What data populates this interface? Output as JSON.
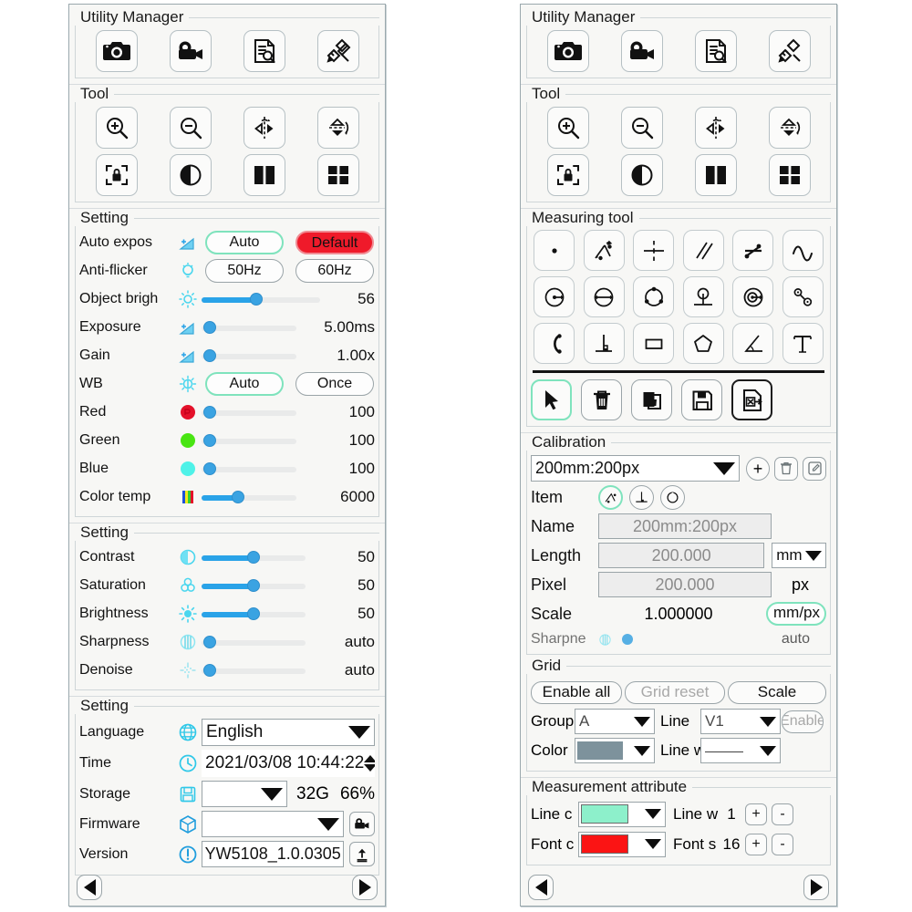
{
  "left_panel": {
    "utility": {
      "title": "Utility Manager",
      "buttons": [
        {
          "name": "snapshot-camera-icon",
          "label": "Snapshot"
        },
        {
          "name": "video-record-icon",
          "label": "Record"
        },
        {
          "name": "document-search-icon",
          "label": "Browse"
        },
        {
          "name": "ruler-pencil-icon",
          "label": "Measure"
        }
      ]
    },
    "tool": {
      "title": "Tool",
      "buttons": [
        {
          "name": "zoom-in-icon",
          "label": "Zoom in"
        },
        {
          "name": "zoom-out-icon",
          "label": "Zoom out"
        },
        {
          "name": "flip-horizontal-icon",
          "label": "Mirror"
        },
        {
          "name": "flip-vertical-icon",
          "label": "Flip"
        },
        {
          "name": "freeze-lock-icon",
          "label": "Freeze"
        },
        {
          "name": "contrast-icon",
          "label": "Contrast"
        },
        {
          "name": "split-view-icon",
          "label": "Split view"
        },
        {
          "name": "quad-view-icon",
          "label": "Quad view"
        }
      ]
    },
    "setting1": {
      "title": "Setting",
      "auto_exposure": {
        "label": "Auto expos",
        "icon": "exposure-icon",
        "auto": "Auto",
        "default": "Default",
        "selected": "Auto"
      },
      "anti_flicker": {
        "label": "Anti-flicker",
        "icon": "bulb-icon",
        "opt1": "50Hz",
        "opt2": "60Hz"
      },
      "object_brightness": {
        "label": "Object brigh",
        "icon": "brightness-icon",
        "value": "56",
        "percent": 46
      },
      "exposure": {
        "label": "Exposure",
        "icon": "exposure-icon",
        "value": "5.00ms",
        "percent": 4
      },
      "gain": {
        "label": "Gain",
        "icon": "exposure-icon",
        "value": "1.00x",
        "percent": 4
      },
      "wb": {
        "label": "WB",
        "icon": "wb-icon",
        "auto": "Auto",
        "once": "Once",
        "selected": "Auto"
      },
      "red": {
        "label": "Red",
        "icon": "red-dot-icon",
        "value": "100",
        "percent": 4,
        "color": "#e4112a"
      },
      "green": {
        "label": "Green",
        "icon": "green-dot-icon",
        "value": "100",
        "percent": 4,
        "color": "#49e512"
      },
      "blue": {
        "label": "Blue",
        "icon": "blue-dot-icon",
        "value": "100",
        "percent": 4,
        "color": "#4ff2e8"
      },
      "color_temp": {
        "label": "Color temp",
        "icon": "color-bars-icon",
        "value": "6000",
        "percent": 38
      }
    },
    "setting2": {
      "title": "Setting",
      "rows": [
        {
          "label": "Contrast",
          "icon": "contrast-small-icon",
          "value": "50",
          "percent": 50
        },
        {
          "label": "Saturation",
          "icon": "saturation-icon",
          "value": "50",
          "percent": 50
        },
        {
          "label": "Brightness",
          "icon": "sun-icon",
          "value": "50",
          "percent": 50
        },
        {
          "label": "Sharpness",
          "icon": "sharpness-icon",
          "value": "auto",
          "percent": 2
        },
        {
          "label": "Denoise",
          "icon": "denoise-icon",
          "value": "auto",
          "percent": 2
        }
      ]
    },
    "setting3": {
      "title": "Setting",
      "language": {
        "label": "Language",
        "icon": "globe-icon",
        "value": "English"
      },
      "time": {
        "label": "Time",
        "icon": "clock-icon",
        "value": "2021/03/08 10:44:22"
      },
      "storage": {
        "label": "Storage",
        "icon": "floppy-icon",
        "value": "",
        "size": "32G",
        "used": "66%"
      },
      "firmware": {
        "label": "Firmware",
        "icon": "cube-icon",
        "value": "",
        "action_icon": "video-record-icon"
      },
      "version": {
        "label": "Version",
        "icon": "alert-icon",
        "value": "YW5108_1.0.0305",
        "action_icon": "upload-icon"
      }
    },
    "nav": {
      "prev": "prev-page",
      "next": "next-page"
    }
  },
  "right_panel": {
    "utility": {
      "title": "Utility Manager",
      "buttons": [
        {
          "name": "snapshot-camera-icon",
          "label": "Snapshot"
        },
        {
          "name": "video-record-icon",
          "label": "Record"
        },
        {
          "name": "document-search-icon",
          "label": "Browse"
        },
        {
          "name": "ruler-pencil-icon",
          "label": "Measure"
        }
      ]
    },
    "tool": {
      "title": "Tool",
      "buttons": [
        {
          "name": "zoom-in-icon",
          "label": "Zoom in"
        },
        {
          "name": "zoom-out-icon",
          "label": "Zoom out"
        },
        {
          "name": "flip-horizontal-icon",
          "label": "Mirror"
        },
        {
          "name": "flip-vertical-icon",
          "label": "Flip"
        },
        {
          "name": "freeze-lock-icon",
          "label": "Freeze"
        },
        {
          "name": "contrast-icon",
          "label": "Contrast"
        },
        {
          "name": "split-view-icon",
          "label": "Split view"
        },
        {
          "name": "quad-view-icon",
          "label": "Quad view"
        }
      ]
    },
    "measuring": {
      "title": "Measuring tool",
      "tools": [
        {
          "name": "point-icon",
          "label": "Point"
        },
        {
          "name": "polyline-distance-icon",
          "label": "Multi point line"
        },
        {
          "name": "crosshair-icon",
          "label": "Cross"
        },
        {
          "name": "parallel-lines-icon",
          "label": "Parallel"
        },
        {
          "name": "zigzag-line-icon",
          "label": "Broken line"
        },
        {
          "name": "wave-icon",
          "label": "Curve"
        },
        {
          "name": "circle-radius-icon",
          "label": "Radius"
        },
        {
          "name": "circle-diameter-icon",
          "label": "Diameter"
        },
        {
          "name": "three-point-circle-icon",
          "label": "3-point circle"
        },
        {
          "name": "circle-tangent-icon",
          "label": "Circle to line"
        },
        {
          "name": "concentric-circle-icon",
          "label": "Annulus"
        },
        {
          "name": "two-circle-distance-icon",
          "label": "Circle to circle"
        },
        {
          "name": "arc-icon",
          "label": "Arc"
        },
        {
          "name": "perpendicular-icon",
          "label": "Perpendicular"
        },
        {
          "name": "rectangle-icon",
          "label": "Rectangle"
        },
        {
          "name": "polygon-icon",
          "label": "Polygon"
        },
        {
          "name": "angle-icon",
          "label": "Angle"
        },
        {
          "name": "text-icon",
          "label": "Text"
        }
      ],
      "actions": [
        {
          "name": "cursor-select-icon",
          "label": "Select",
          "selected": true
        },
        {
          "name": "trash-icon",
          "label": "Delete"
        },
        {
          "name": "delete-all-icon",
          "label": "Delete all"
        },
        {
          "name": "save-floppy-icon",
          "label": "Save"
        },
        {
          "name": "export-excel-icon",
          "label": "Export to Excel"
        }
      ]
    },
    "calibration": {
      "title": "Calibration",
      "preset": "200mm:200px",
      "add_label": "+",
      "delete_icon": "trash-icon",
      "edit_icon": "edit-icon",
      "item": {
        "label": "Item",
        "icons": [
          {
            "name": "polyline-distance-icon",
            "selected": true
          },
          {
            "name": "perpendicular-icon",
            "selected": false
          },
          {
            "name": "circle-icon",
            "selected": false
          }
        ]
      },
      "name": {
        "label": "Name",
        "value": "200mm:200px"
      },
      "length": {
        "label": "Length",
        "value": "200.000",
        "unit": "mm"
      },
      "pixel": {
        "label": "Pixel",
        "value": "200.000",
        "unit": "px"
      },
      "scale": {
        "label": "Scale",
        "value": "1.000000",
        "unit": "mm/px"
      }
    },
    "clipped_row": {
      "label": "Sharpne",
      "value": "auto",
      "icon": "sharpness-icon"
    },
    "grid": {
      "title": "Grid",
      "enable_all": "Enable all",
      "grid_reset": "Grid reset",
      "scale": "Scale",
      "group": {
        "label": "Group",
        "value": "A"
      },
      "line": {
        "label": "Line",
        "value": "V1"
      },
      "enable": "Enable",
      "color": {
        "label": "Color",
        "value": "#7d929c"
      },
      "line_width": {
        "label": "Line w",
        "value": "———"
      }
    },
    "measurement_attribute": {
      "title": "Measurement attribute",
      "line_color": {
        "label": "Line c",
        "value": "#8df0cb"
      },
      "line_width": {
        "label": "Line w",
        "value": "1",
        "plus": "+",
        "minus": "-"
      },
      "font_color": {
        "label": "Font c",
        "value": "#fb1414"
      },
      "font_size": {
        "label": "Font s",
        "value": "16",
        "plus": "+",
        "minus": "-"
      }
    },
    "nav": {
      "prev": "prev-page",
      "next": "next-page"
    }
  }
}
